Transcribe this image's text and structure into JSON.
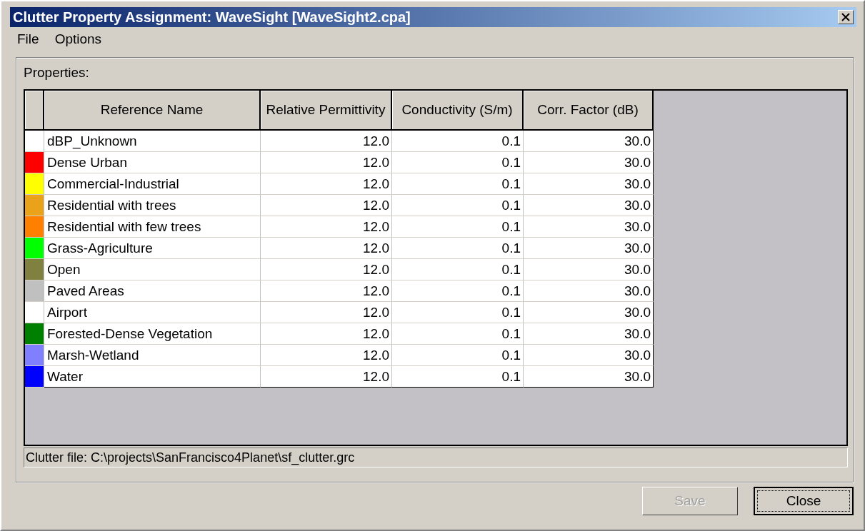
{
  "window": {
    "title": "Clutter Property Assignment: WaveSight [WaveSight2.cpa]"
  },
  "menu": [
    "File",
    "Options"
  ],
  "group": {
    "label": "Properties:"
  },
  "table": {
    "columns": [
      "Reference Name",
      "Relative Permittivity",
      "Conductivity (S/m)",
      "Corr. Factor (dB)"
    ],
    "rows": [
      {
        "color": "#ffffff",
        "cells": [
          "dBP_Unknown",
          "12.0",
          "0.1",
          "30.0"
        ]
      },
      {
        "color": "#ff0000",
        "cells": [
          "Dense Urban",
          "12.0",
          "0.1",
          "30.0"
        ]
      },
      {
        "color": "#ffff00",
        "cells": [
          "Commercial-Industrial",
          "12.0",
          "0.1",
          "30.0"
        ]
      },
      {
        "color": "#eaa21a",
        "cells": [
          "Residential with trees",
          "12.0",
          "0.1",
          "30.0"
        ]
      },
      {
        "color": "#ff8000",
        "cells": [
          "Residential with few trees",
          "12.0",
          "0.1",
          "30.0"
        ]
      },
      {
        "color": "#00ff00",
        "cells": [
          "Grass-Agriculture",
          "12.0",
          "0.1",
          "30.0"
        ]
      },
      {
        "color": "#808040",
        "cells": [
          "Open",
          "12.0",
          "0.1",
          "30.0"
        ]
      },
      {
        "color": "#c0c0c0",
        "cells": [
          "Paved Areas",
          "12.0",
          "0.1",
          "30.0"
        ]
      },
      {
        "color": "#ffffff",
        "cells": [
          "Airport",
          "12.0",
          "0.1",
          "30.0"
        ]
      },
      {
        "color": "#008000",
        "cells": [
          "Forested-Dense Vegetation",
          "12.0",
          "0.1",
          "30.0"
        ]
      },
      {
        "color": "#8080ff",
        "cells": [
          "Marsh-Wetland",
          "12.0",
          "0.1",
          "30.0"
        ]
      },
      {
        "color": "#0000ff",
        "cells": [
          "Water",
          "12.0",
          "0.1",
          "30.0"
        ]
      }
    ]
  },
  "status": "Clutter file: C:\\projects\\SanFrancisco4Planet\\sf_clutter.grc",
  "buttons": [
    {
      "label": "Save",
      "disabled": true,
      "focused": false
    },
    {
      "label": "Close",
      "disabled": false,
      "focused": true
    }
  ]
}
